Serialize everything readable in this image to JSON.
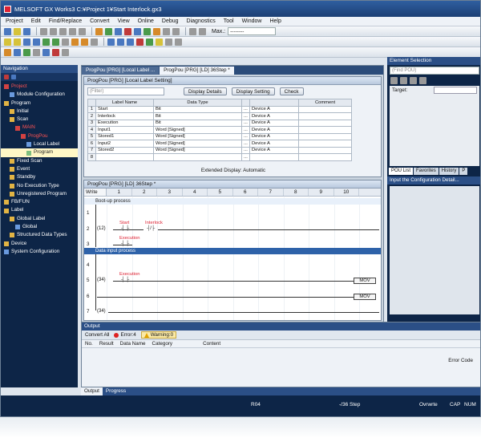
{
  "window": {
    "title": "MELSOFT GX Works3 C:¥Project 1¥Start Interlock.gx3"
  },
  "menu": [
    "Project",
    "Edit",
    "Find/Replace",
    "Convert",
    "View",
    "Online",
    "Debug",
    "Diagnostics",
    "Tool",
    "Window",
    "Help"
  ],
  "toolbar": {
    "max_label": "Max.:",
    "max_value": "--------"
  },
  "navigation": {
    "title": "Navigation",
    "items": [
      {
        "label": "Project",
        "style": "red",
        "indent": 0,
        "icon": "project-icon"
      },
      {
        "label": "Module Configuration",
        "indent": 1,
        "icon": "module-icon"
      },
      {
        "label": "Program",
        "indent": 0,
        "icon": "folder-icon"
      },
      {
        "label": "Initial",
        "indent": 1,
        "icon": "folder-icon"
      },
      {
        "label": "Scan",
        "indent": 1,
        "icon": "folder-icon"
      },
      {
        "label": "MAIN",
        "style": "red",
        "indent": 2,
        "icon": "program-file-icon"
      },
      {
        "label": "ProgPou",
        "style": "red",
        "indent": 3,
        "icon": "pou-icon"
      },
      {
        "label": "Local Label",
        "indent": 4,
        "icon": "label-icon"
      },
      {
        "label": "Program",
        "indent": 4,
        "icon": "program-icon",
        "selected": true
      },
      {
        "label": "Fixed Scan",
        "indent": 1,
        "icon": "folder-icon"
      },
      {
        "label": "Event",
        "indent": 1,
        "icon": "folder-icon"
      },
      {
        "label": "Standby",
        "indent": 1,
        "icon": "folder-icon"
      },
      {
        "label": "No Execution Type",
        "indent": 1,
        "icon": "folder-icon"
      },
      {
        "label": "Unregistered Program",
        "indent": 1,
        "icon": "folder-icon"
      },
      {
        "label": "FB/FUN",
        "indent": 0,
        "icon": "folder-icon"
      },
      {
        "label": "Label",
        "indent": 0,
        "icon": "folder-icon"
      },
      {
        "label": "Global Label",
        "indent": 1,
        "icon": "folder-icon"
      },
      {
        "label": "Global",
        "indent": 2,
        "icon": "label-icon"
      },
      {
        "label": "Structured Data Types",
        "indent": 1,
        "icon": "folder-icon"
      },
      {
        "label": "Device",
        "indent": 0,
        "icon": "folder-icon"
      },
      {
        "label": "System Configuration",
        "indent": 0,
        "icon": "system-icon"
      }
    ]
  },
  "tabs": [
    {
      "label": "ProgPou [PRG] [Local Label ...",
      "active": false
    },
    {
      "label": "ProgPou [PRG] [LD] 36Step *",
      "active": true
    }
  ],
  "label_window": {
    "title": "ProgPou [PRG] [Local Label Setting]",
    "filter_placeholder": "(Filter)",
    "btn_details": "Display Details",
    "btn_setting": "Display Setting",
    "btn_check": "Check",
    "columns": [
      "",
      "Label Name",
      "Data Type",
      "",
      "",
      "Comment"
    ],
    "rows": [
      [
        "1",
        "Start",
        "Bit",
        "...",
        "Device A",
        ""
      ],
      [
        "2",
        "Interlock",
        "Bit",
        "...",
        "Device A",
        ""
      ],
      [
        "3",
        "Execution",
        "Bit",
        "...",
        "Device A",
        ""
      ],
      [
        "4",
        "Input1",
        "Word [Signed]",
        "...",
        "Device A",
        ""
      ],
      [
        "5",
        "Stored1",
        "Word [Signed]",
        "...",
        "Device A",
        ""
      ],
      [
        "6",
        "Input2",
        "Word [Signed]",
        "...",
        "Device A",
        ""
      ],
      [
        "7",
        "Stored2",
        "Word [Signed]",
        "...",
        "Device A",
        ""
      ],
      [
        "8",
        "",
        "",
        "...",
        "",
        ""
      ]
    ],
    "ext_display": "Extended Display: Automatic"
  },
  "ladder": {
    "title": "ProgPou [PRG] [LD] 36Step *",
    "mode": "Write",
    "columns": [
      "1",
      "2",
      "3",
      "4",
      "5",
      "6",
      "7",
      "8",
      "9",
      "10"
    ],
    "rung1_comment": "Boot-up process",
    "rung2_comment": "Data input process",
    "rows": [
      {
        "num": "1"
      },
      {
        "num": "2",
        "step": "(12)",
        "contact1": "Start",
        "contact2": "Interlock"
      },
      {
        "num": "3",
        "contact1": "Execution"
      },
      {
        "num": "4"
      },
      {
        "num": "5",
        "step": "(34)",
        "contact1": "Execution",
        "box": "MOV"
      },
      {
        "num": "6",
        "box": "MOV"
      },
      {
        "num": "7",
        "step": "(34)"
      }
    ]
  },
  "right_panel": {
    "title": "Element Selection",
    "search_placeholder": "(Find POU)",
    "target_label": "Target:",
    "tabs": [
      "POU List",
      "Favorites",
      "History",
      "P"
    ],
    "help_title": "Input the Configuration Detail..."
  },
  "output": {
    "title": "Output",
    "convert_all": "Convert All",
    "error_label": "Error:4",
    "warning_label": "Warning:0",
    "columns": [
      "No.",
      "Result",
      "Data Name",
      "Category",
      "Content"
    ],
    "error_code": "Error Code"
  },
  "bottom_tabs": [
    "Output",
    "Progress"
  ],
  "status": {
    "r": "R04",
    "step": "-/36 Step",
    "ovr": "Ovrwrte",
    "cap": "CAP",
    "num": "NUM"
  }
}
